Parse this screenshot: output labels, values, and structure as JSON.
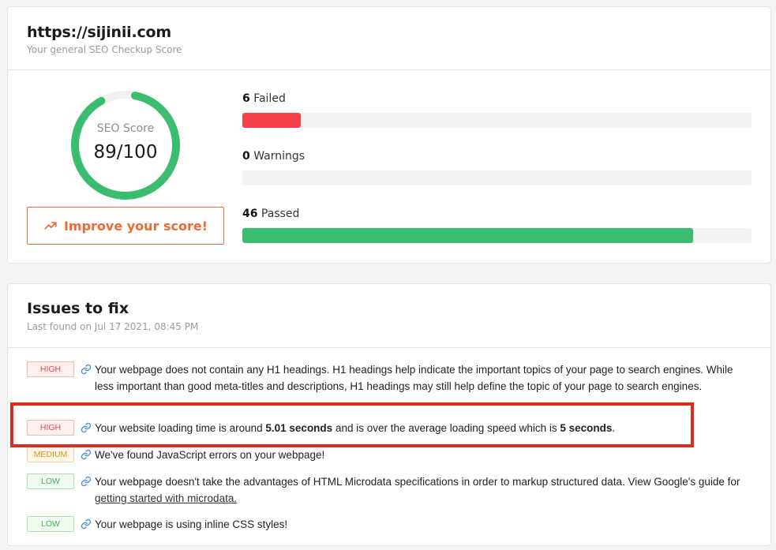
{
  "score_card": {
    "site_url": "https://sijinii.com",
    "subtitle": "Your general SEO Checkup Score",
    "gauge_label": "SEO Score",
    "gauge_value": "89/100",
    "score_fraction": 0.89,
    "improve_label": "Improve your score!",
    "stats": [
      {
        "count": "6",
        "label": " Failed",
        "fraction": 0.115,
        "color": "#f5414a"
      },
      {
        "count": "0",
        "label": " Warnings",
        "fraction": 0,
        "color": "#f5a623"
      },
      {
        "count": "46",
        "label": " Passed",
        "fraction": 0.885,
        "color": "#3bbd6f"
      }
    ]
  },
  "issues_card": {
    "title": "Issues to fix",
    "subtitle": "Last found on Jul 17 2021, 08:45 PM",
    "issues": [
      {
        "severity": "HIGH",
        "text": "Your webpage does not contain any H1 headings. H1 headings help indicate the important topics of your page to search engines. While less important than good meta-titles and descriptions, H1 headings may still help define the topic of your page to search engines."
      },
      {
        "severity": "HIGH",
        "text_before": "Your website loading time is around ",
        "bold_1": "5.01 seconds",
        "text_middle": " and is over the average loading speed which is ",
        "bold_2": "5 seconds",
        "text_after": "."
      },
      {
        "severity": "MEDIUM",
        "text": "We've found JavaScript errors on your webpage!"
      },
      {
        "severity": "LOW",
        "text_before": "Your webpage doesn't take the advantages of HTML Microdata specifications in order to markup structured data. View Google's guide for ",
        "link": "getting started with microdata.",
        "text_after": ""
      },
      {
        "severity": "LOW",
        "text": "Your webpage is using inline CSS styles!"
      }
    ]
  },
  "colors": {
    "accent": "#ee6a32",
    "gauge": "#3bbd6f",
    "highlight": "#dd2c1c"
  }
}
